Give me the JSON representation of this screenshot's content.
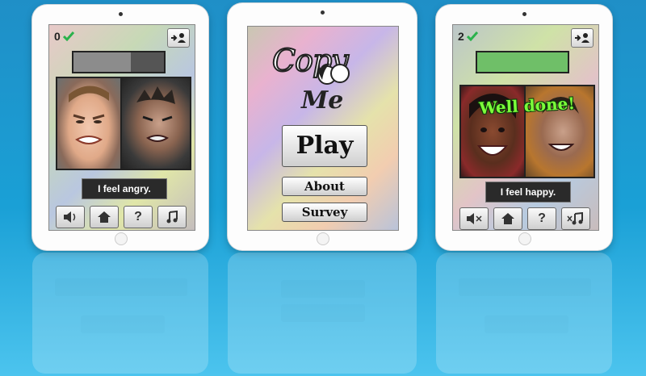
{
  "left_device": {
    "score": "0",
    "caption": "I feel angry.",
    "progress": 0.63,
    "toolbar_icons": [
      "speaker-icon",
      "home-icon",
      "question-icon",
      "music-note-icon"
    ],
    "question_glyph": "?",
    "colors": {
      "progress_fill": "#8c8c8c",
      "check": "#2bb24c"
    }
  },
  "center_device": {
    "logo_copy": "Copy",
    "logo_me": "Me",
    "play_label": "Play",
    "about_label": "About",
    "survey_label": "Survey"
  },
  "right_device": {
    "score": "2",
    "caption": "I feel happy.",
    "banner": "Well done!",
    "progress": 1.0,
    "toolbar_icons": [
      "speaker-muted-icon",
      "home-icon",
      "question-icon",
      "music-muted-icon"
    ],
    "question_glyph": "?",
    "colors": {
      "progress_fill": "#6fbf68",
      "banner": "#7cff3a"
    }
  },
  "colors": {
    "background": "#1aa0d6"
  }
}
